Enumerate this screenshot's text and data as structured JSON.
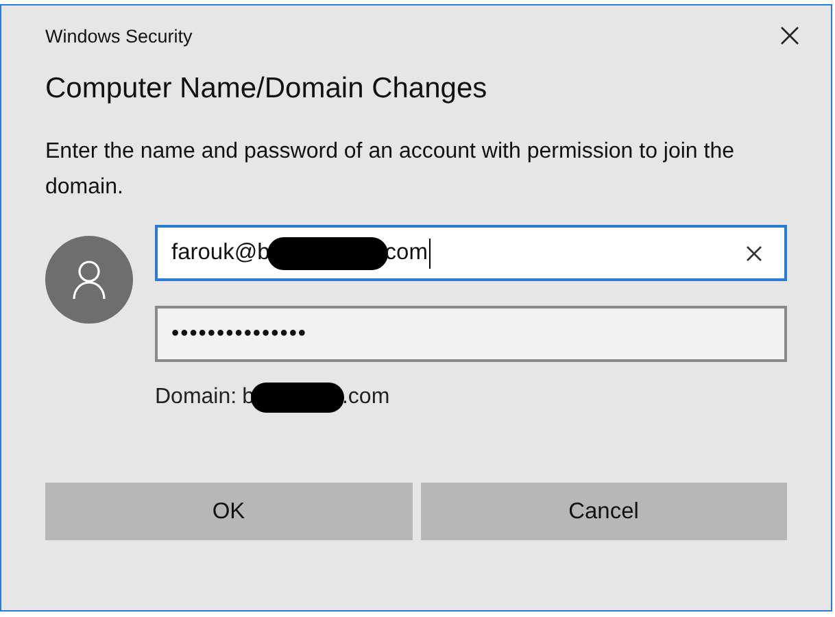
{
  "window": {
    "title": "Windows Security"
  },
  "heading": "Computer Name/Domain Changes",
  "message": "Enter the name and password of an account with permission to join the domain.",
  "username_field": {
    "visible_parts": [
      "farouk@b",
      "com"
    ],
    "focused": true
  },
  "password_field": {
    "value": "•••••••••••••••",
    "focused": false
  },
  "domain": {
    "label": "Domain:",
    "visible_parts": [
      "b",
      ".com"
    ]
  },
  "buttons": [
    "OK",
    "Cancel"
  ]
}
